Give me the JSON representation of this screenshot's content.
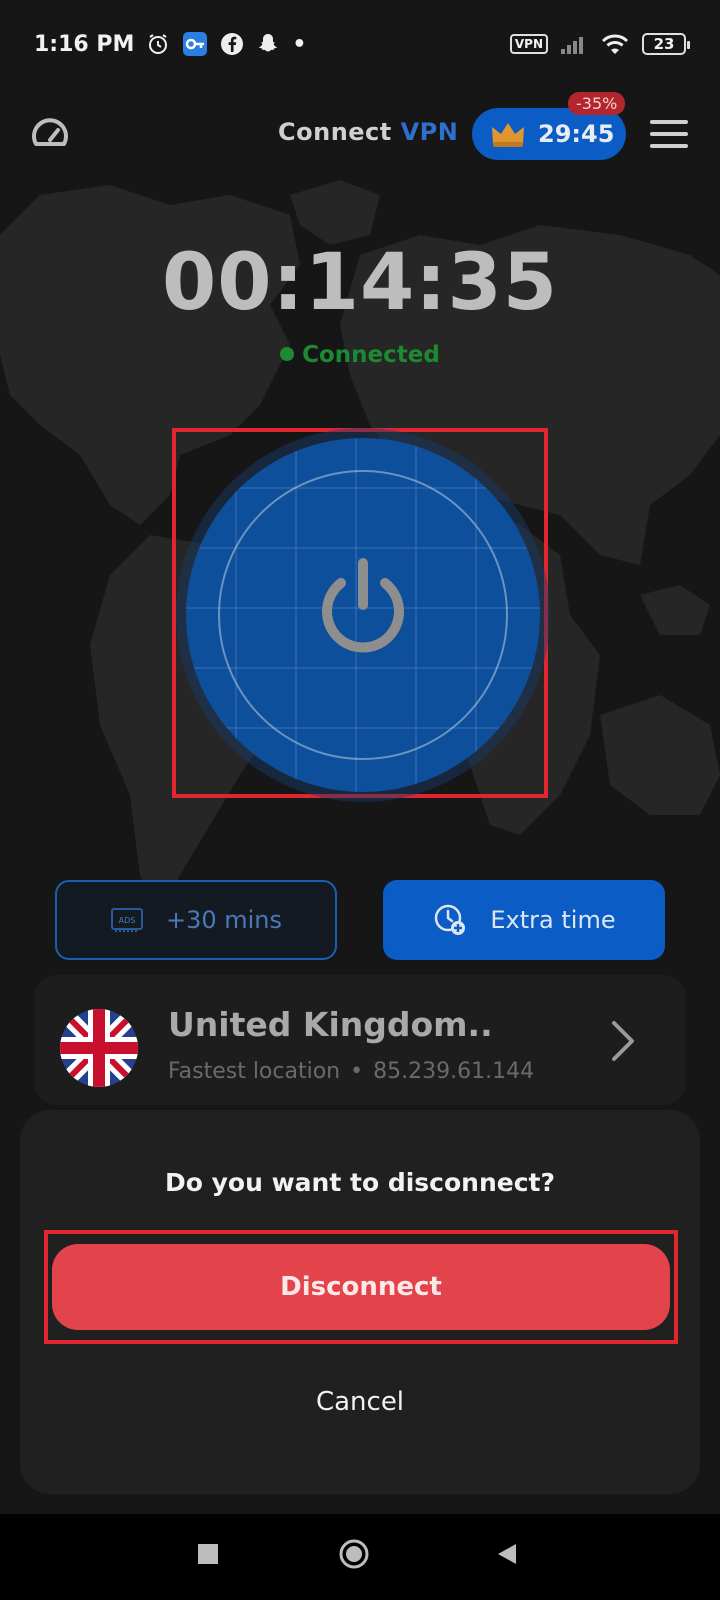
{
  "status_bar": {
    "time": "1:16 PM",
    "vpn_badge": "VPN",
    "battery": "23"
  },
  "header": {
    "title_prefix": "Connect",
    "title_accent": "VPN",
    "premium_timer": "29:45",
    "discount": "-35%"
  },
  "session": {
    "timer": "00:14:35",
    "status": "Connected"
  },
  "actions": {
    "ads_label": "+30 mins",
    "ads_tag": "ADS",
    "extra_label": "Extra time"
  },
  "location": {
    "country": "United Kingdom..",
    "type": "Fastest location",
    "ip": "85.239.61.144"
  },
  "dialog": {
    "question": "Do you want to disconnect?",
    "confirm": "Disconnect",
    "cancel": "Cancel"
  },
  "colors": {
    "accent": "#0b5cc4",
    "connected": "#1c8a32",
    "danger": "#e3434a"
  }
}
